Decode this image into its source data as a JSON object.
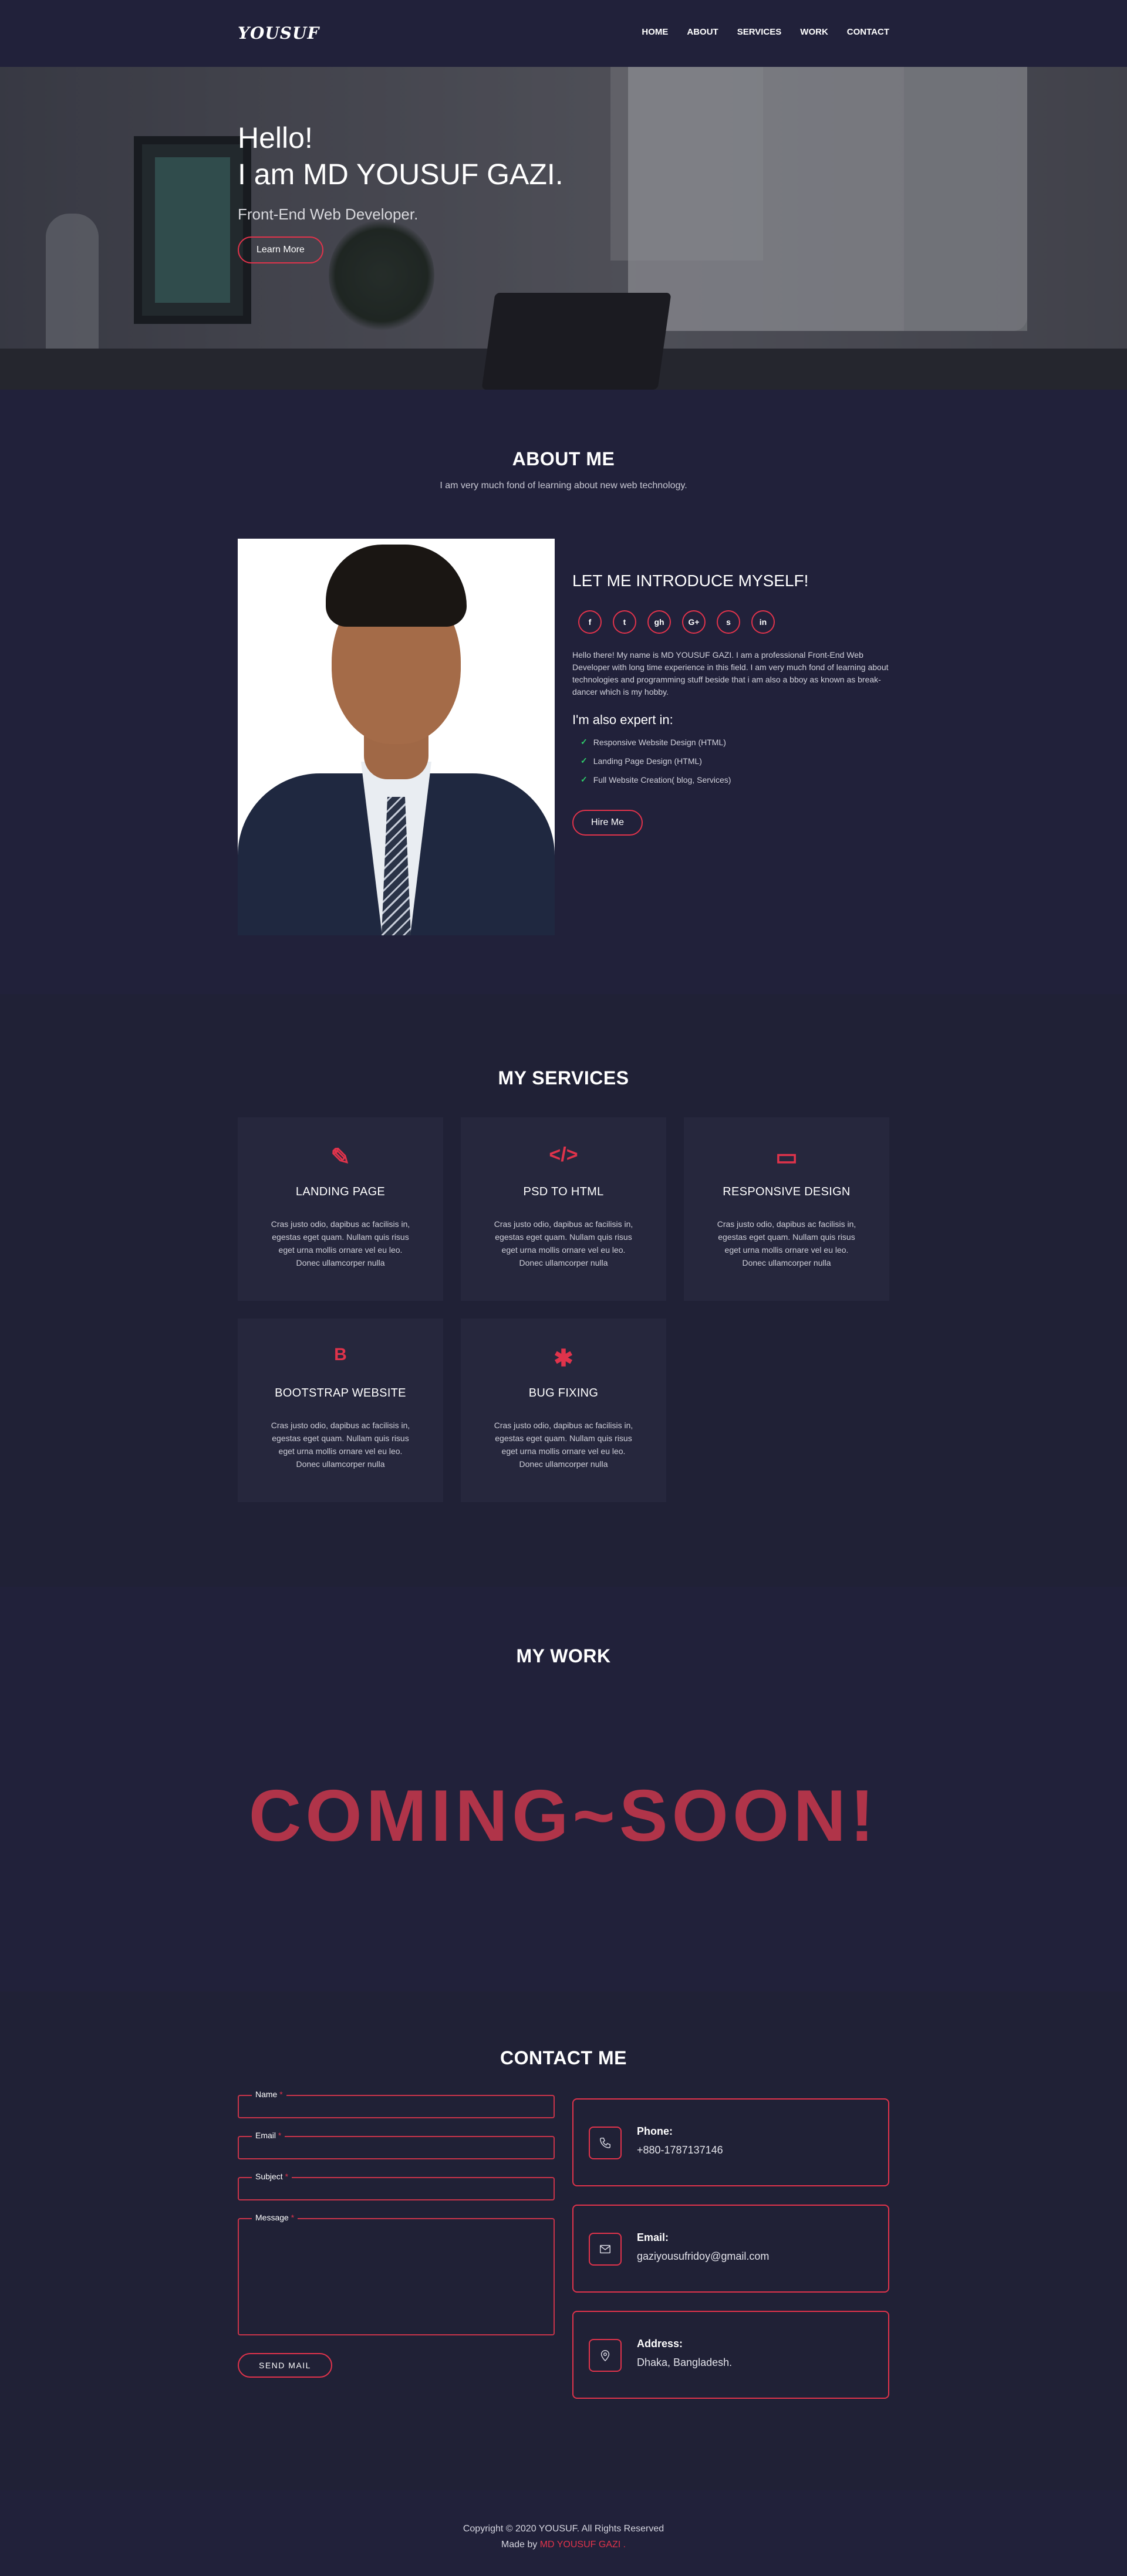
{
  "header": {
    "logo": "YOUSUF",
    "nav": [
      "HOME",
      "ABOUT",
      "SERVICES",
      "WORK",
      "CONTACT"
    ]
  },
  "hero": {
    "line1": "Hello!",
    "line2": "I am MD YOUSUF GAZI.",
    "subtitle": "Front-End Web Developer.",
    "button": "Learn More"
  },
  "about": {
    "title": "ABOUT ME",
    "subtitle": "I am very much fond of learning about new web technology.",
    "intro_title": "LET ME INTRODUCE MYSELF!",
    "socials": [
      "f",
      "t",
      "gh",
      "G+",
      "s",
      "in"
    ],
    "paragraph": "Hello there! My name is MD YOUSUF GAZI. I am a professional Front-End Web Developer with long time experience in this field. I am very much fond of learning about technologies and programming stuff beside that i am also a bboy as known as break-dancer which is my hobby.",
    "expert_title": "I'm also expert in:",
    "skills": [
      "Responsive Website Design (HTML)",
      "Landing Page Design (HTML)",
      "Full Website Creation( blog, Services)"
    ],
    "button": "Hire Me"
  },
  "services": {
    "title": "MY SERVICES",
    "items": [
      {
        "icon": "pencil-ruler-icon",
        "glyph": "✎",
        "title": "LANDING PAGE",
        "text": "Cras justo odio, dapibus ac facilisis in, egestas eget quam. Nullam quis risus eget urna mollis ornare vel eu leo. Donec ullamcorper nulla"
      },
      {
        "icon": "code-icon",
        "glyph": "</>",
        "title": "PSD TO HTML",
        "text": "Cras justo odio, dapibus ac facilisis in, egestas eget quam. Nullam quis risus eget urna mollis ornare vel eu leo. Donec ullamcorper nulla"
      },
      {
        "icon": "desktop-icon",
        "glyph": "▭",
        "title": "RESPONSIVE DESIGN",
        "text": "Cras justo odio, dapibus ac facilisis in, egestas eget quam. Nullam quis risus eget urna mollis ornare vel eu leo. Donec ullamcorper nulla"
      },
      {
        "icon": "bootstrap-icon",
        "glyph": "B",
        "title": "BOOTSTRAP WEBSITE",
        "text": "Cras justo odio, dapibus ac facilisis in, egestas eget quam. Nullam quis risus eget urna mollis ornare vel eu leo. Donec ullamcorper nulla"
      },
      {
        "icon": "bug-icon",
        "glyph": "✱",
        "title": "BUG FIXING",
        "text": "Cras justo odio, dapibus ac facilisis in, egestas eget quam. Nullam quis risus eget urna mollis ornare vel eu leo. Donec ullamcorper nulla"
      }
    ]
  },
  "work": {
    "title": "MY WORK",
    "coming": "COMING~SOON!"
  },
  "contact": {
    "title": "CONTACT ME",
    "fields": {
      "name": "Name",
      "email": "Email",
      "subject": "Subject",
      "message": "Message",
      "required": "*"
    },
    "button": "SEND MAIL",
    "phone": {
      "label": "Phone:",
      "value": "+880-1787137146"
    },
    "email": {
      "label": "Email:",
      "value": "gaziyousufridoy@gmail.com"
    },
    "address": {
      "label": "Address:",
      "value": "Dhaka, Bangladesh."
    }
  },
  "footer": {
    "copyright": "Copyright © 2020 YOUSUF. All Rights Reserved",
    "made_by": "Made by",
    "author": "MD YOUSUF GAZI",
    "period": "."
  },
  "colors": {
    "accent": "#e0334b",
    "background": "#202136",
    "coming_soon": "#b03449"
  }
}
